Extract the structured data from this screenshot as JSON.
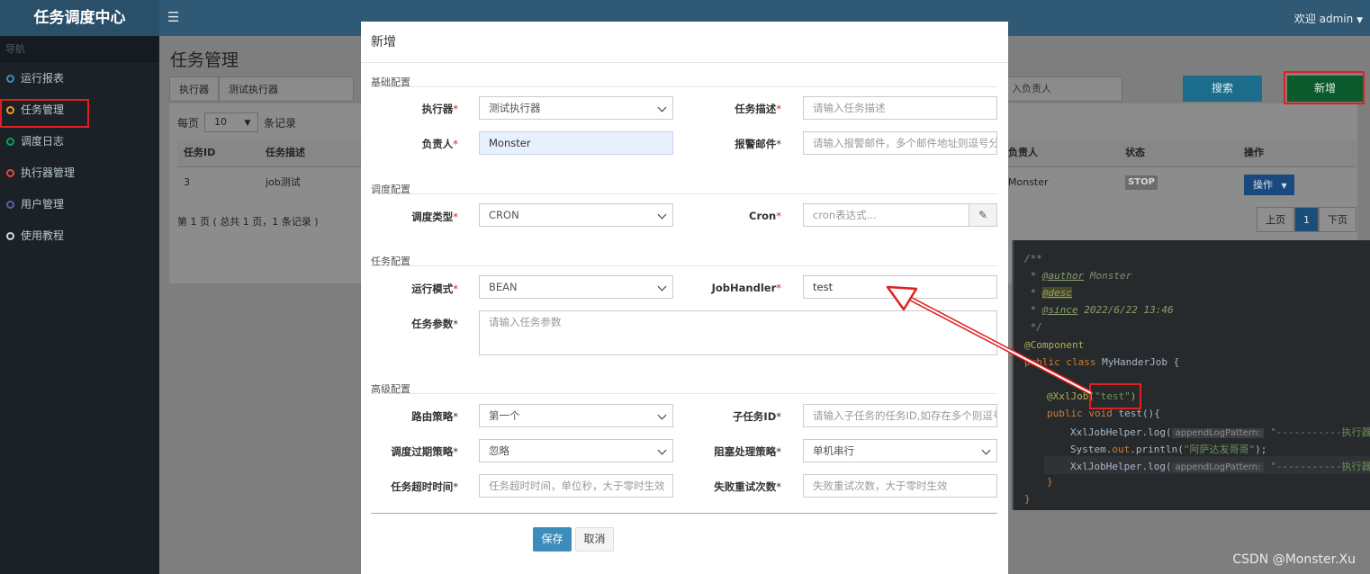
{
  "app": {
    "title": "任务调度中心",
    "welcome": "欢迎 admin"
  },
  "sidebar": {
    "header": "导航",
    "items": [
      {
        "label": "运行报表",
        "color": "#3c8dbc"
      },
      {
        "label": "任务管理",
        "color": "#f39c12"
      },
      {
        "label": "调度日志",
        "color": "#00a65a"
      },
      {
        "label": "执行器管理",
        "color": "#dd4b39"
      },
      {
        "label": "用户管理",
        "color": "#605ca8"
      },
      {
        "label": "使用教程",
        "color": "#d2d6de"
      }
    ]
  },
  "page": {
    "title": "任务管理",
    "filter_executor_label": "执行器",
    "filter_executor_value": "测试执行器",
    "owner_placeholder": "入负责人",
    "search_label": "搜索",
    "new_label": "新增",
    "per_page_prefix": "每页",
    "per_page_value": "10",
    "per_page_suffix": "条记录",
    "table_headers": [
      "任务ID",
      "任务描述",
      "负责人",
      "状态",
      "操作"
    ],
    "row": {
      "id": "3",
      "desc": "job测试",
      "owner": "Monster",
      "status": "STOP",
      "action": "操作"
    },
    "pager_text": "第 1 页 ( 总共 1 页，1 条记录 )",
    "pager": {
      "prev": "上页",
      "current": "1",
      "next": "下页"
    }
  },
  "modal": {
    "title": "新增",
    "sections": {
      "basic": "基础配置",
      "schedule": "调度配置",
      "task": "任务配置",
      "advanced": "高级配置"
    },
    "fields": {
      "executor": {
        "label": "执行器",
        "value": "测试执行器"
      },
      "job_desc": {
        "label": "任务描述",
        "placeholder": "请输入任务描述"
      },
      "author": {
        "label": "负责人",
        "value": "Monster"
      },
      "alarm_email": {
        "label": "报警邮件",
        "placeholder": "请输入报警邮件，多个邮件地址则逗号分隔"
      },
      "schedule_type": {
        "label": "调度类型",
        "value": "CRON"
      },
      "cron": {
        "label": "Cron",
        "placeholder": "cron表达式..."
      },
      "run_mode": {
        "label": "运行模式",
        "value": "BEAN"
      },
      "job_handler": {
        "label": "JobHandler",
        "value": "test"
      },
      "job_param": {
        "label": "任务参数",
        "placeholder": "请输入任务参数"
      },
      "route_strategy": {
        "label": "路由策略",
        "value": "第一个"
      },
      "child_job": {
        "label": "子任务ID",
        "placeholder": "请输入子任务的任务ID,如存在多个则逗号分隔"
      },
      "misfire_strategy": {
        "label": "调度过期策略",
        "value": "忽略"
      },
      "block_strategy": {
        "label": "阻塞处理策略",
        "value": "单机串行"
      },
      "timeout": {
        "label": "任务超时时间",
        "placeholder": "任务超时时间，单位秒，大于零时生效"
      },
      "fail_retry": {
        "label": "失败重试次数",
        "placeholder": "失败重试次数，大于零时生效"
      }
    },
    "save_label": "保存",
    "cancel_label": "取消"
  },
  "code": {
    "lines": {
      "l1": "/**",
      "l2_tag": "@author",
      "l2_text": " Monster",
      "l3_tag": "@desc",
      "l4_tag": "@since",
      "l4_text": " 2022/6/22 13:46",
      "l5": " */",
      "l6": "@Component",
      "l7_kw": "public class",
      "l7_name": " MyHanderJob {",
      "l8_ann": "@XxlJob(",
      "l8_str": "\"test\"",
      "l8_end": ")",
      "l9_kw": "public void",
      "l9_text": " test(){",
      "l10_a": "XxlJobHelper.log(",
      "l10_hint": "appendLogPattern:",
      "l10_str": " \"-----------执行器开",
      "l11_a": "System.",
      "l11_b": "out",
      "l11_c": ".println(",
      "l11_str": "\"阿萨达发哥哥\"",
      "l11_end": ");",
      "l12_a": "XxlJobHelper.log(",
      "l12_hint": "appendLogPattern:",
      "l12_str": " \"-----------执行器结",
      "l13": "}",
      "l14": "}"
    }
  },
  "watermark": "CSDN @Monster.Xu",
  "colors": {
    "accent": "#3c8dbc",
    "highlight": "#e02020"
  }
}
